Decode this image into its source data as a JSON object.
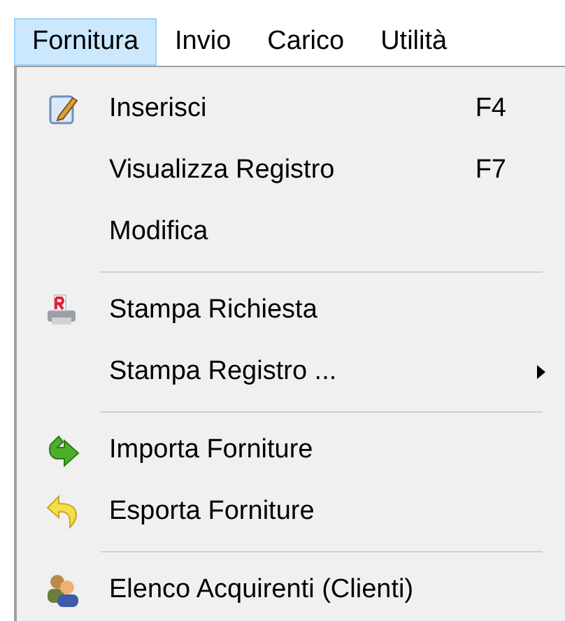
{
  "menubar": [
    {
      "label": "Fornitura",
      "selected": true
    },
    {
      "label": "Invio",
      "selected": false
    },
    {
      "label": "Carico",
      "selected": false
    },
    {
      "label": "Utilità",
      "selected": false
    }
  ],
  "menu": [
    {
      "kind": "item",
      "label": "Inserisci",
      "shortcut": "F4"
    },
    {
      "kind": "item",
      "label": "Visualizza Registro",
      "shortcut": "F7"
    },
    {
      "kind": "item",
      "label": "Modifica"
    },
    {
      "kind": "separator"
    },
    {
      "kind": "item",
      "label": "Stampa Richiesta"
    },
    {
      "kind": "item",
      "label": "Stampa Registro ...",
      "submenu": true
    },
    {
      "kind": "separator"
    },
    {
      "kind": "item",
      "label": "Importa Forniture"
    },
    {
      "kind": "item",
      "label": "Esporta Forniture"
    },
    {
      "kind": "separator"
    },
    {
      "kind": "item",
      "label": "Elenco Acquirenti (Clienti)"
    }
  ]
}
